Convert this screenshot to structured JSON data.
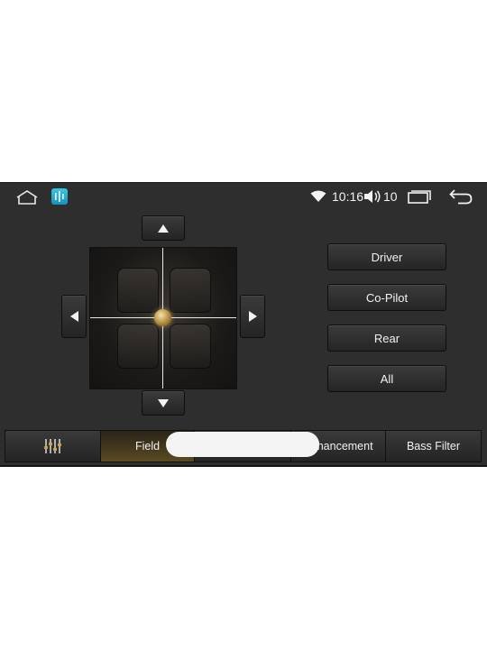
{
  "status_bar": {
    "time": "10:16",
    "volume": "10",
    "icons": [
      "home-icon",
      "equalizer-app-icon",
      "wifi-icon",
      "volume-icon",
      "recents-icon",
      "back-icon"
    ]
  },
  "seat_field": {
    "arrows": [
      "arrow-up-icon",
      "arrow-down-icon",
      "arrow-left-icon",
      "arrow-right-icon"
    ]
  },
  "presets": [
    {
      "label": "Driver"
    },
    {
      "label": "Co-Pilot"
    },
    {
      "label": "Rear"
    },
    {
      "label": "All"
    }
  ],
  "tabs": {
    "eq_icon": "equalizer-sliders-icon",
    "items": [
      {
        "label": "Field",
        "active": true
      },
      {
        "label": "Enhancement"
      },
      {
        "label": "Bass Filter"
      }
    ]
  },
  "colors": {
    "screen_bg": "#2e2e2e",
    "active_tab": "#5b4a22",
    "knob": "#b08a3c",
    "text": "#f2f2f2"
  }
}
